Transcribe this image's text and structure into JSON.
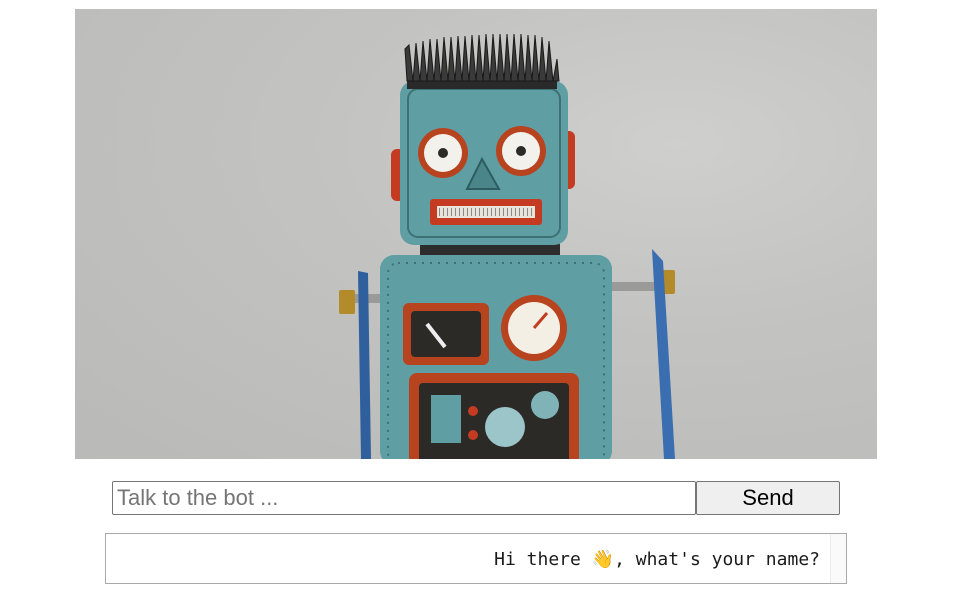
{
  "hero": {
    "image": "robot-toy-photo",
    "colors": {
      "background": "#c3c3c1",
      "robot_body": "#5f9ea3",
      "robot_accent": "#c43b22",
      "robot_hair": "#2a2a2a"
    }
  },
  "chat": {
    "input_placeholder": "Talk to the bot ...",
    "input_value": "",
    "send_label": "Send"
  },
  "messages": [
    {
      "sender": "bot",
      "text": "Hi there 👋, what's your name?"
    }
  ]
}
